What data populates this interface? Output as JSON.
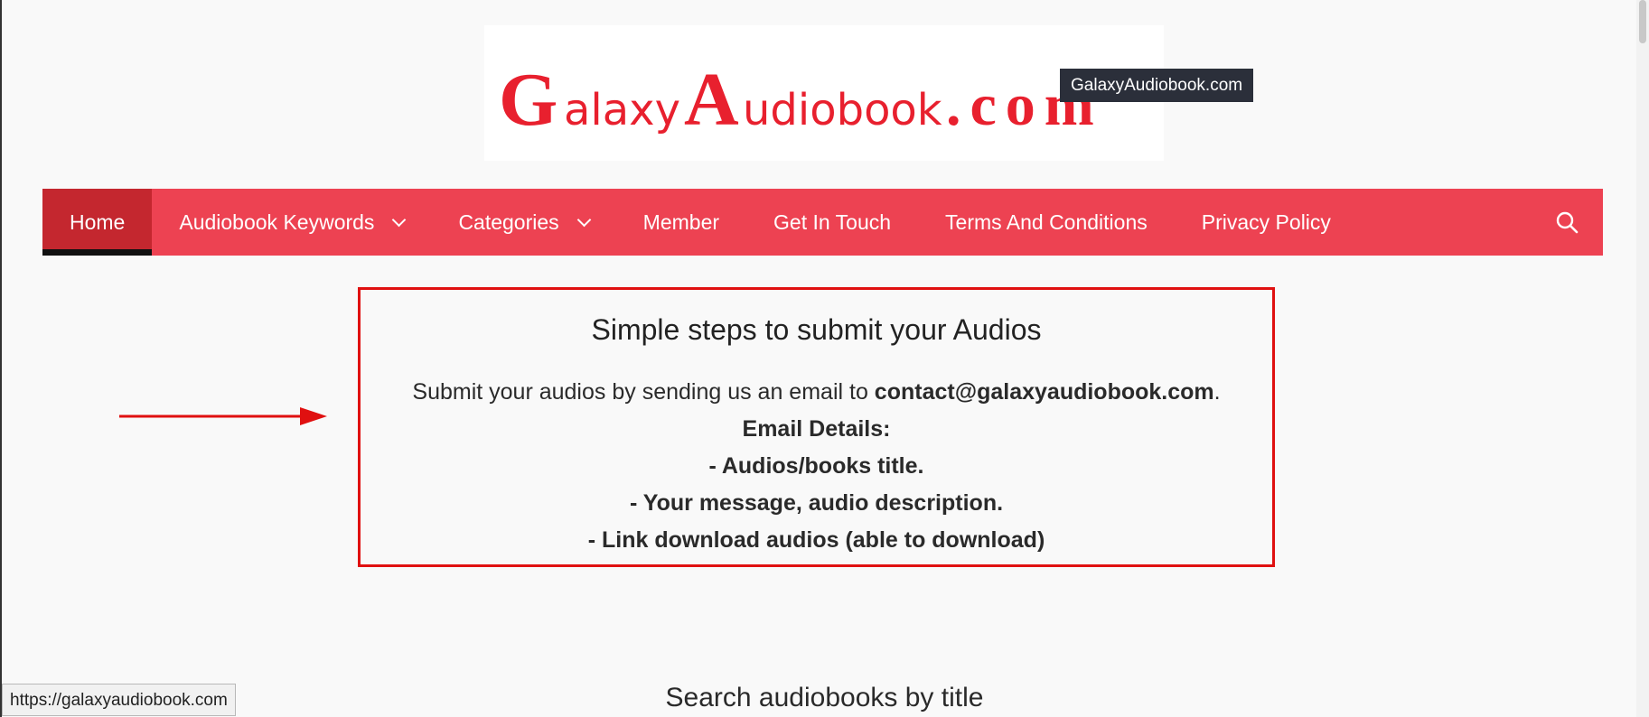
{
  "logo": {
    "text_parts": [
      "G",
      "alaxy",
      "A",
      "udiobook",
      ".com"
    ],
    "tooltip": "GalaxyAudiobook.com",
    "brand_color": "#e8202e"
  },
  "nav": {
    "items": [
      {
        "label": "Home",
        "active": true,
        "has_dropdown": false
      },
      {
        "label": "Audiobook Keywords",
        "active": false,
        "has_dropdown": true
      },
      {
        "label": "Categories",
        "active": false,
        "has_dropdown": true
      },
      {
        "label": "Member",
        "active": false,
        "has_dropdown": false
      },
      {
        "label": "Get In Touch",
        "active": false,
        "has_dropdown": false
      },
      {
        "label": "Terms And Conditions",
        "active": false,
        "has_dropdown": false
      },
      {
        "label": "Privacy Policy",
        "active": false,
        "has_dropdown": false
      }
    ],
    "search_icon": "search-icon",
    "bg_color": "#ed4252",
    "active_color": "#c4272f"
  },
  "submit": {
    "title": "Simple steps to submit your Audios",
    "intro": "Submit your audios by sending us an email to ",
    "email": "contact@galaxyaudiobook.com",
    "intro_end": ".",
    "details_heading": "Email Details:",
    "details": [
      "- Audios/books title.",
      "- Your message, audio description.",
      "- Link download audios (able to download)"
    ],
    "border_color": "#e01010"
  },
  "search_heading": "Search audiobooks by title",
  "status_bar": {
    "url": "https://galaxyaudiobook.com"
  }
}
